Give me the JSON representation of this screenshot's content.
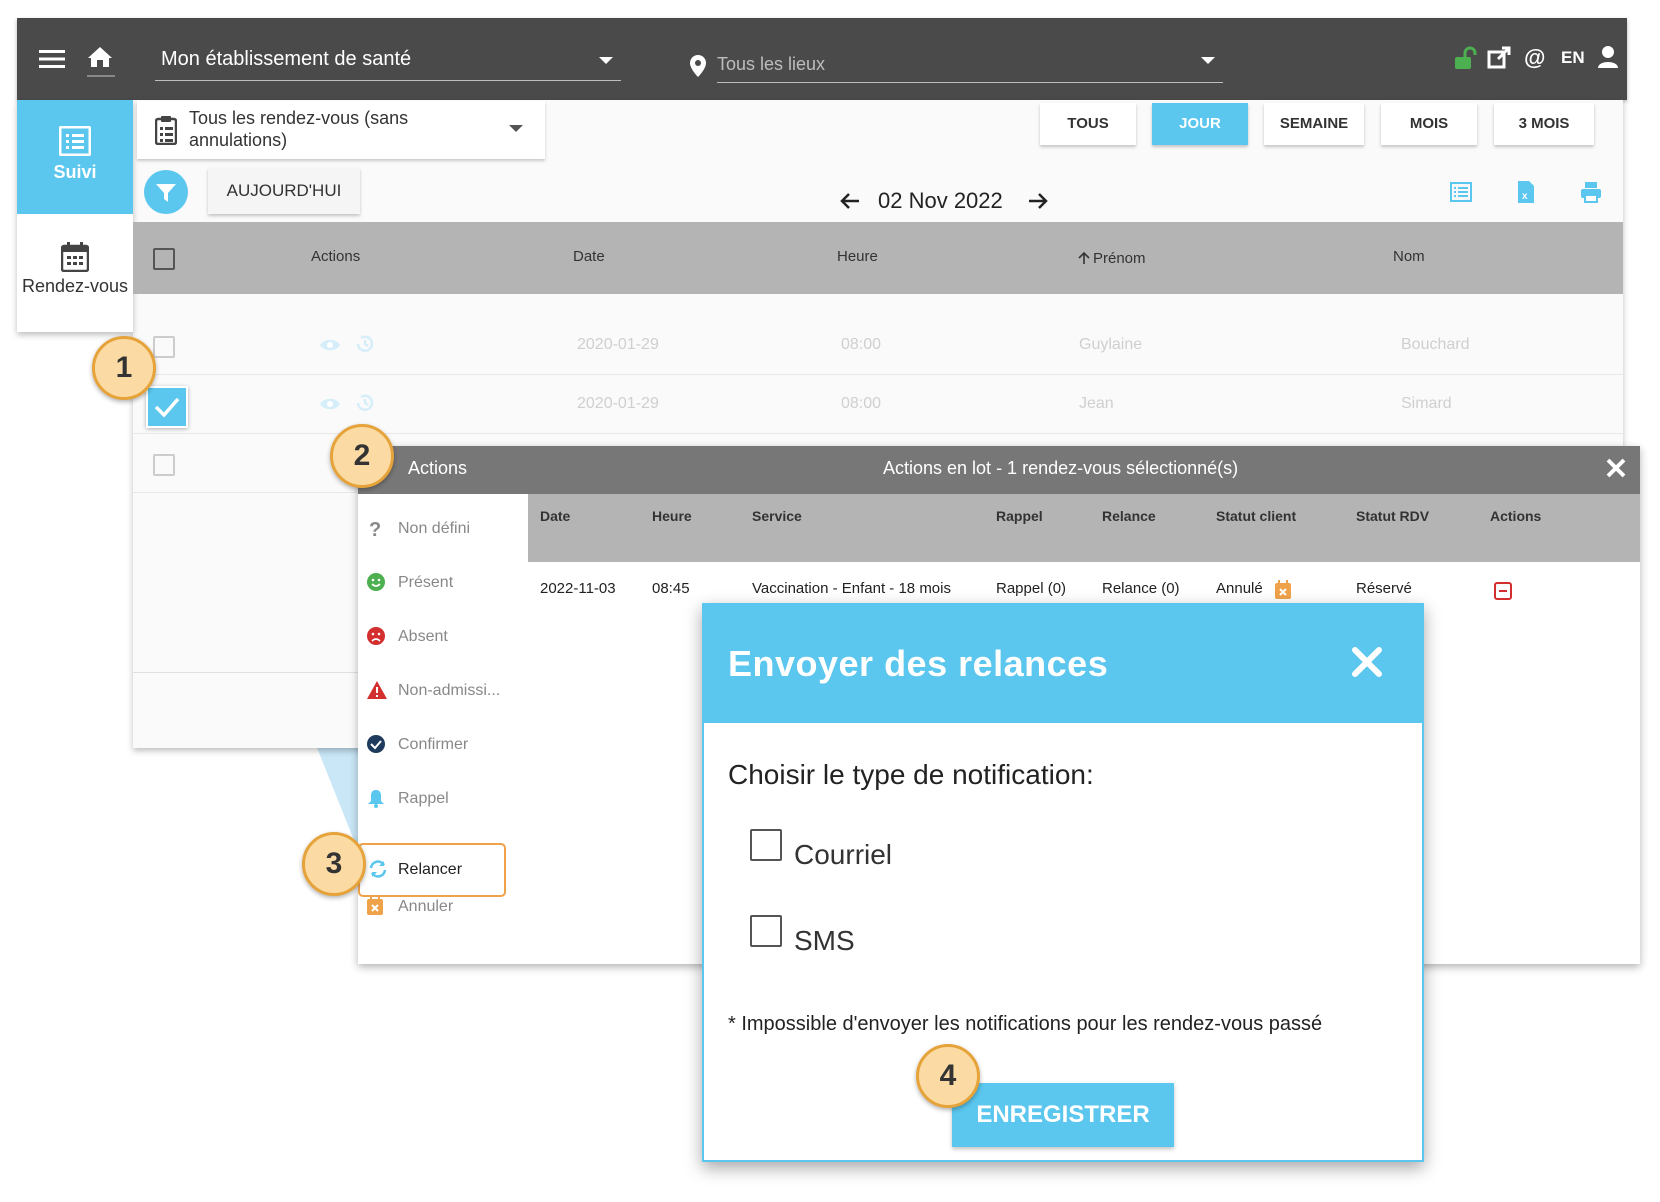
{
  "topbar": {
    "establishment": "Mon établissement de santé",
    "location_placeholder": "Tous les lieux",
    "lang": "EN"
  },
  "leftnav": {
    "items": [
      {
        "label": "Suivi",
        "active": true
      },
      {
        "label": "Rendez-vous",
        "active": false
      }
    ]
  },
  "toolbar": {
    "filter_value": "Tous les rendez-vous (sans annulations)",
    "views": [
      "TOUS",
      "JOUR",
      "SEMAINE",
      "MOIS",
      "3 MOIS"
    ],
    "active_view": "JOUR",
    "today_label": "AUJOURD'HUI",
    "current_date": "02 Nov 2022"
  },
  "table": {
    "headers": [
      "Actions",
      "Date",
      "Heure",
      "Prénom",
      "Nom"
    ],
    "sort_column": "Prénom",
    "rows": [
      {
        "date": "2020-01-29",
        "heure": "08:00",
        "prenom": "Guylaine",
        "nom": "Bouchard"
      },
      {
        "date": "2020-01-29",
        "heure": "08:00",
        "prenom": "Jean",
        "nom": "Simard"
      }
    ]
  },
  "batch": {
    "actions_label": "Actions",
    "title": "Actions en lot - 1 rendez-vous sélectionné(s)",
    "side_items": [
      "Non défini",
      "Présent",
      "Absent",
      "Non-admissi...",
      "Confirmer",
      "Rappel",
      "Relancer",
      "Annuler"
    ],
    "headers": [
      "Date",
      "Heure",
      "Service",
      "Rappel",
      "Relance",
      "Statut client",
      "Statut RDV",
      "Actions"
    ],
    "row": {
      "date": "2022-11-03",
      "heure": "08:45",
      "service": "Vaccination - Enfant - 18 mois",
      "rappel": "Rappel (0)",
      "relance": "Relance (0)",
      "statut_client": "Annulé",
      "statut_rdv": "Réservé"
    }
  },
  "modal": {
    "title": "Envoyer des relances",
    "prompt": "Choisir le type de notification:",
    "options": [
      "Courriel",
      "SMS"
    ],
    "note": "* Impossible d'envoyer les notifications pour les rendez-vous passé",
    "save_label": "ENREGISTRER"
  },
  "callouts": [
    "1",
    "2",
    "3",
    "4"
  ],
  "colors": {
    "accent": "#5bc6ee",
    "topbar": "#4a4a4a",
    "callout_fill": "#fbdba3",
    "callout_border": "#e6a33a",
    "danger": "#d32f2f",
    "success": "#4caf50",
    "warning": "#f0a24a"
  }
}
